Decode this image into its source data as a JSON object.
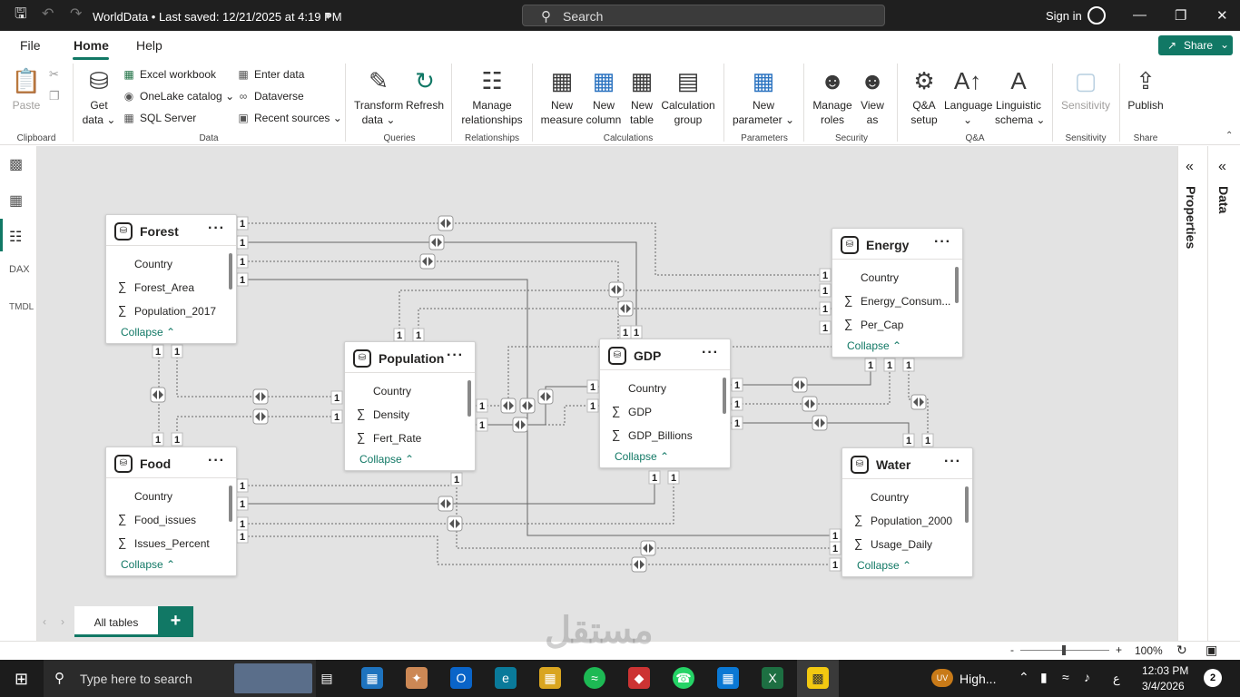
{
  "titlebar": {
    "doc_title": "WorldData • Last saved: 12/21/2025 at 4:19 PM",
    "search_label": "Search",
    "signin": "Sign in"
  },
  "menu": {
    "file": "File",
    "home": "Home",
    "help": "Help",
    "share": "Share"
  },
  "ribbon": {
    "paste": "Paste",
    "get_data_1": "Get",
    "get_data_2": "data ⌄",
    "excel": "Excel workbook",
    "onelake": "OneLake catalog ⌄",
    "sql": "SQL Server",
    "enter_data": "Enter data",
    "dataverse": "Dataverse",
    "recent_sources": "Recent sources ⌄",
    "transform_1": "Transform",
    "transform_2": "data ⌄",
    "refresh": "Refresh",
    "manage_rel_1": "Manage",
    "manage_rel_2": "relationships",
    "new_measure_1": "New",
    "new_measure_2": "measure",
    "new_column_1": "New",
    "new_column_2": "column",
    "new_table_1": "New",
    "new_table_2": "table",
    "calc_group_1": "Calculation",
    "calc_group_2": "group",
    "new_param_1": "New",
    "new_param_2": "parameter ⌄",
    "manage_roles_1": "Manage",
    "manage_roles_2": "roles",
    "view_as_1": "View",
    "view_as_2": "as",
    "qa_setup_1": "Q&A",
    "qa_setup_2": "setup",
    "language_1": "Language",
    "language_2": "⌄",
    "ling_1": "Linguistic",
    "ling_2": "schema ⌄",
    "sensitivity": "Sensitivity",
    "publish": "Publish",
    "groups": {
      "clipboard": "Clipboard",
      "data": "Data",
      "queries": "Queries",
      "relationships": "Relationships",
      "calculations": "Calculations",
      "parameters": "Parameters",
      "security": "Security",
      "qa": "Q&A",
      "sensitivity": "Sensitivity",
      "share": "Share"
    }
  },
  "panes": {
    "properties": "Properties",
    "data": "Data"
  },
  "tables": {
    "forest": {
      "name": "Forest",
      "fields": [
        "Country",
        "Forest_Area",
        "Population_2017"
      ],
      "collapse": "Collapse"
    },
    "energy": {
      "name": "Energy",
      "fields": [
        "Country",
        "Energy_Consum...",
        "Per_Cap"
      ],
      "collapse": "Collapse"
    },
    "population": {
      "name": "Population",
      "fields": [
        "Country",
        "Density",
        "Fert_Rate"
      ],
      "collapse": "Collapse"
    },
    "gdp": {
      "name": "GDP",
      "fields": [
        "Country",
        "GDP",
        "GDP_Billions"
      ],
      "collapse": "Collapse"
    },
    "food": {
      "name": "Food",
      "fields": [
        "Country",
        "Food_issues",
        "Issues_Percent"
      ],
      "collapse": "Collapse"
    },
    "water": {
      "name": "Water",
      "fields": [
        "Country",
        "Population_2000",
        "Usage_Daily"
      ],
      "collapse": "Collapse"
    }
  },
  "more": "···",
  "sigma": "∑",
  "cardinality": "1",
  "tabs": {
    "all_tables": "All tables",
    "add": "+"
  },
  "status": {
    "zoom": "100%",
    "minus": "-",
    "plus": "+"
  },
  "taskbar": {
    "search": "Type here to search",
    "weather": "High...",
    "time": "12:03 PM",
    "date": "3/4/2026",
    "lang": "ع",
    "notif": "2"
  },
  "watermark": "مستقل"
}
